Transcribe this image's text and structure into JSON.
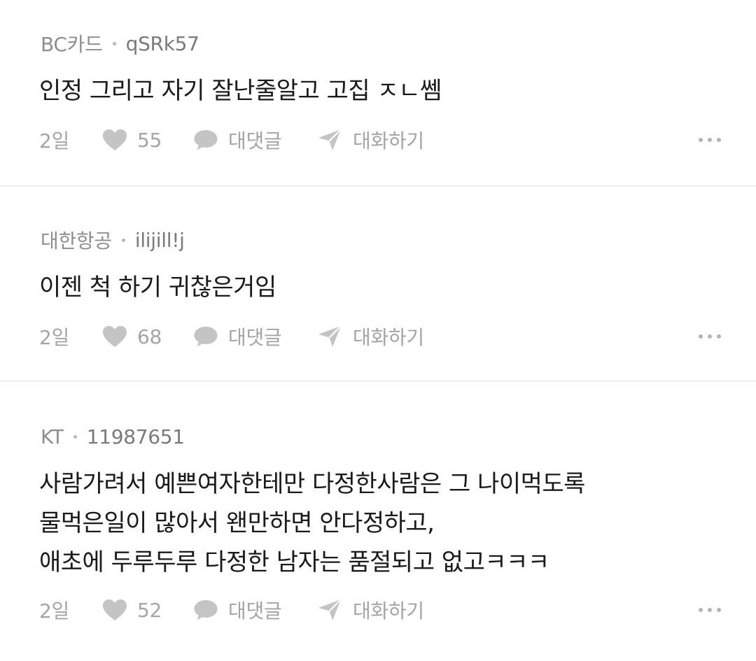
{
  "comments": [
    {
      "carrier": "BC카드",
      "nickname": "qSRk57",
      "text": "인정 그리고 자기 잘난줄알고 고집 ㅈㄴ쎔",
      "age": "2일",
      "likes": "55",
      "reply_label": "대댓글",
      "chat_label": "대화하기"
    },
    {
      "carrier": "대한항공",
      "nickname": "ilijill!j",
      "text": "이젠 척 하기 귀찮은거임",
      "age": "2일",
      "likes": "68",
      "reply_label": "대댓글",
      "chat_label": "대화하기"
    },
    {
      "carrier": "KT",
      "nickname": "11987651",
      "text": "사람가려서 예쁜여자한테만 다정한사람은 그 나이먹도록\n물먹은일이 많아서 왠만하면 안다정하고,\n애초에 두루두루 다정한 남자는 품절되고 없고ㅋㅋㅋ",
      "age": "2일",
      "likes": "52",
      "reply_label": "대댓글",
      "chat_label": "대화하기"
    }
  ],
  "icons": {
    "like": "heart-icon",
    "reply": "speech-bubble-icon",
    "chat": "paper-plane-icon",
    "more": "more-dots-icon"
  },
  "colors": {
    "icon_gray": "#c4c4c4",
    "text_primary": "#1a1a1a",
    "text_secondary": "#8a8a8a",
    "divider": "#eeeeee"
  }
}
